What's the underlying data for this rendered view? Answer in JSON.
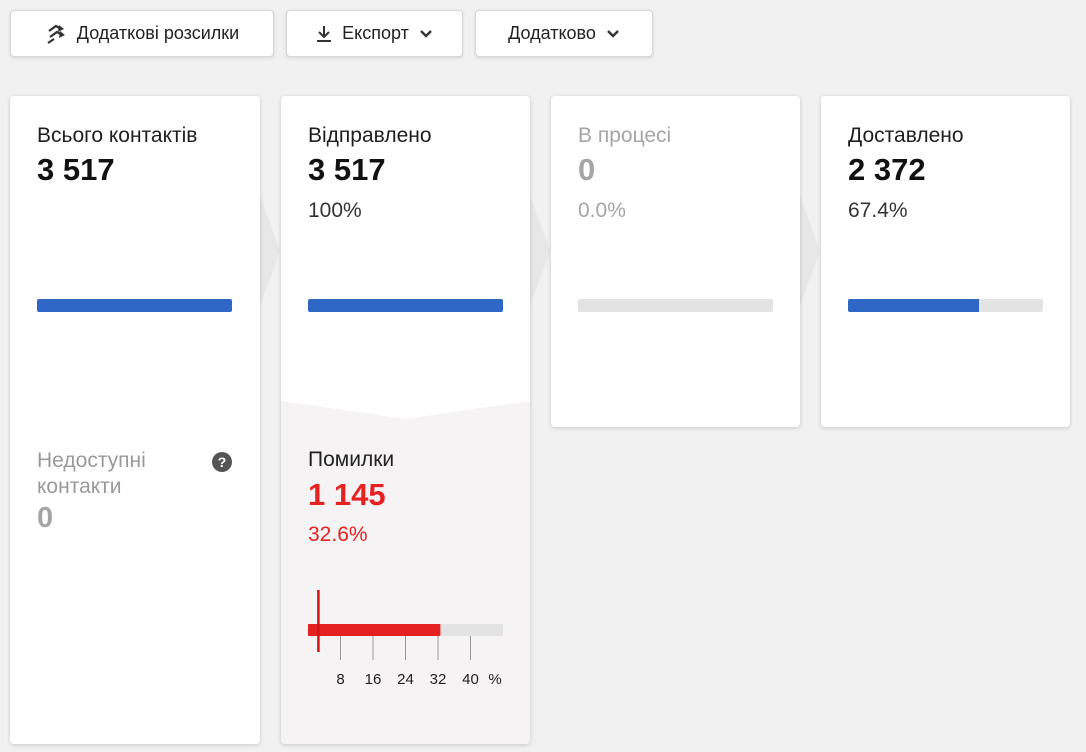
{
  "toolbar": {
    "extra_mailings": "Додаткові розсилки",
    "export": "Експорт",
    "more": "Додатково"
  },
  "stats": {
    "total": {
      "label": "Всього контактів",
      "value": "3 517",
      "bar_fraction": 1.0
    },
    "sent": {
      "label": "Відправлено",
      "value": "3 517",
      "percent": "100%",
      "bar_fraction": 1.0
    },
    "in_progress": {
      "label": "В процесі",
      "value": "0",
      "percent": "0.0%",
      "bar_fraction": 0.0
    },
    "delivered": {
      "label": "Доставлено",
      "value": "2 372",
      "percent": "67.4%",
      "bar_fraction": 0.674
    }
  },
  "unavailable": {
    "label": "Недоступні контакти",
    "value": "0"
  },
  "errors": {
    "label": "Помилки",
    "value": "1 145",
    "percent": "32.6%",
    "scale_max": 48,
    "error_value": 32.6,
    "marker_value": 2.5,
    "ticks": [
      "8",
      "16",
      "24",
      "32",
      "40"
    ],
    "tick_values": [
      8,
      16,
      24,
      32,
      40
    ],
    "unit": "%"
  },
  "colors": {
    "accent_blue": "#2e67c6",
    "error_red": "#e52222",
    "track_grey": "#e3e3e3"
  }
}
